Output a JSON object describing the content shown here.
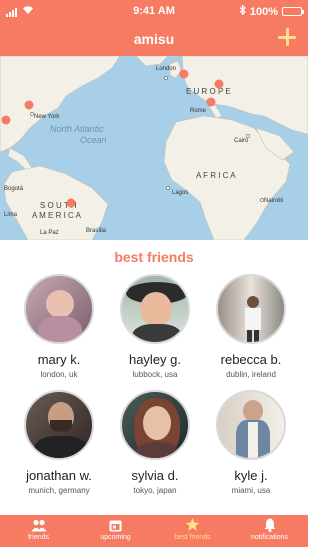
{
  "status_bar": {
    "time": "9:41 AM",
    "battery": "100%",
    "icons": [
      "signal-icon",
      "wifi-icon",
      "bluetooth-icon",
      "battery-icon"
    ]
  },
  "nav": {
    "title": "amisu",
    "add_icon": "plus-icon"
  },
  "map": {
    "labels": {
      "london": "London",
      "europe": "E U R O P E",
      "rome": "Rome",
      "new_york": "New York",
      "ocean_line1": "North Atlantic",
      "ocean_line2": "Ocean",
      "cairo": "Cairo",
      "africa": "A F R I C A",
      "lagos": "Lagos",
      "nairobi": "Nairobi",
      "south": "S O U T H",
      "america": "A M E R I C A",
      "bogota": "Bogotá",
      "lima": "Lima",
      "la_paz": "La Paz",
      "brasilia": "Brasília"
    },
    "pin_color": "#f77b62",
    "water_color": "#a8cfe8",
    "land_color": "#f3f0e8"
  },
  "section": {
    "title": "best friends"
  },
  "friends": [
    {
      "name": "mary k.",
      "location": "london, uk"
    },
    {
      "name": "hayley g.",
      "location": "lubbock, usa"
    },
    {
      "name": "rebecca b.",
      "location": "dublin, ireland"
    },
    {
      "name": "jonathan w.",
      "location": "munich, germany"
    },
    {
      "name": "sylvia d.",
      "location": "tokyo, japan"
    },
    {
      "name": "kyle j.",
      "location": "miami, usa"
    }
  ],
  "tabs": [
    {
      "label": "friends",
      "icon": "people-icon",
      "active": false
    },
    {
      "label": "upcoming",
      "icon": "calendar-icon",
      "active": false
    },
    {
      "label": "best friends",
      "icon": "star-icon",
      "active": true
    },
    {
      "label": "notifications",
      "icon": "bell-icon",
      "active": false
    }
  ],
  "colors": {
    "accent": "#f77b62",
    "highlight": "#ffe08a"
  }
}
